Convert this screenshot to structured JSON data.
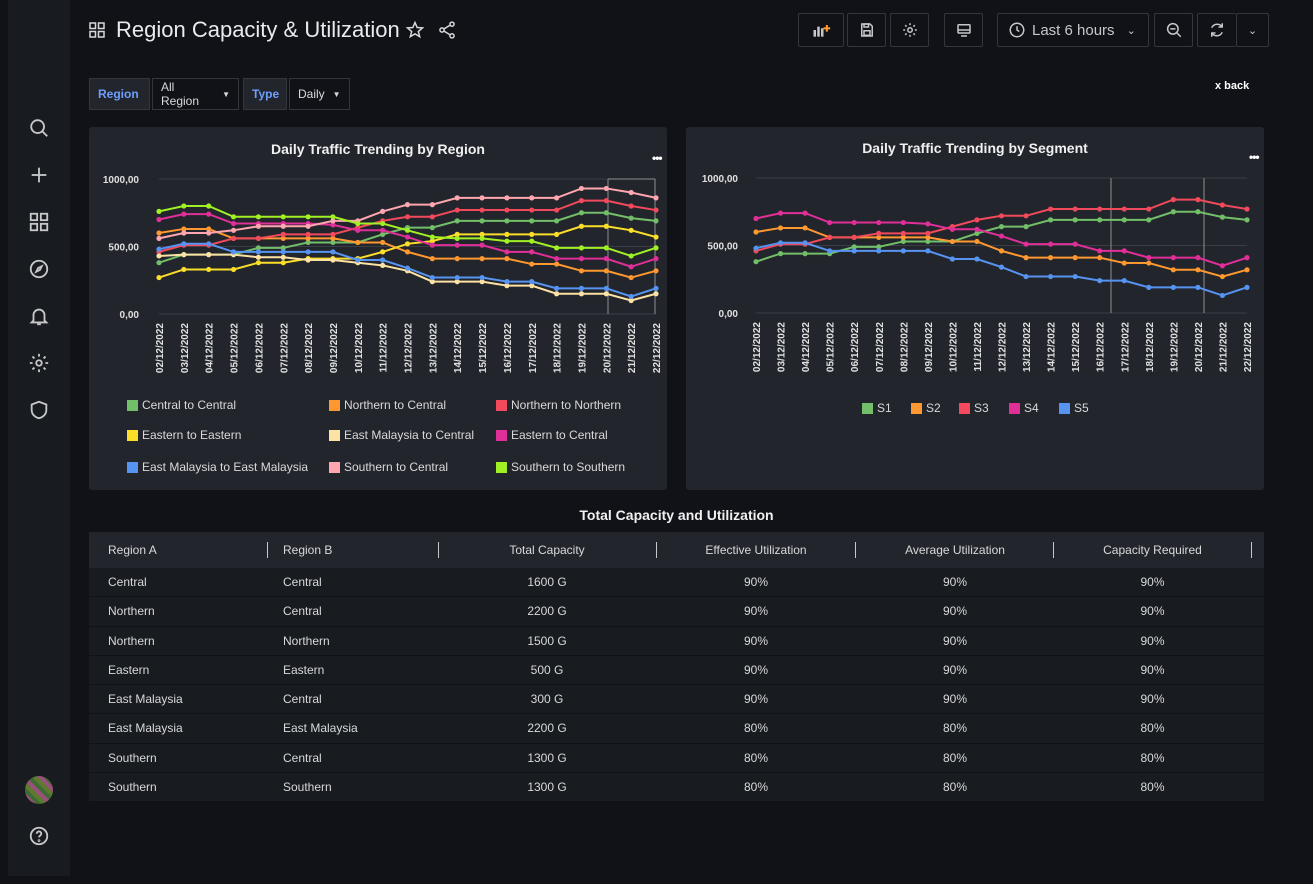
{
  "header": {
    "title": "Region Capacity & Utilization",
    "time_range": "Last 6 hours"
  },
  "filters": {
    "region_label": "Region",
    "region_value": "All Region",
    "type_label": "Type",
    "type_value": "Daily"
  },
  "back_link": "x back",
  "colors": {
    "background": "#111217",
    "panel": "#22252b",
    "accent_label": "#6e9fff"
  },
  "chart_data": [
    {
      "type": "line",
      "title": "Daily Traffic Trending by Region",
      "x": [
        "02/12/2022",
        "03/12/2022",
        "04/12/2022",
        "05/12/2022",
        "06/12/2022",
        "07/12/2022",
        "08/12/2022",
        "09/12/2022",
        "10/12/2022",
        "11/12/2022",
        "12/12/2022",
        "13/12/2022",
        "14/12/2022",
        "15/12/2022",
        "16/12/2022",
        "17/12/2022",
        "18/12/2022",
        "19/12/2022",
        "20/12/2022",
        "21/12/2022",
        "22/12/2022"
      ],
      "y_ticks": [
        "1000,00",
        "500,00",
        "0,00"
      ],
      "ylim": [
        0,
        1000
      ],
      "series": [
        {
          "name": "Central to Central",
          "color": "#73bf69",
          "values": [
            380,
            440,
            440,
            440,
            490,
            490,
            530,
            530,
            530,
            590,
            640,
            640,
            690,
            690,
            690,
            690,
            690,
            750,
            750,
            710,
            690
          ]
        },
        {
          "name": "Northern to Central",
          "color": "#ff9830",
          "values": [
            600,
            630,
            630,
            560,
            560,
            560,
            560,
            560,
            530,
            530,
            460,
            410,
            410,
            410,
            410,
            370,
            370,
            320,
            320,
            270,
            320
          ]
        },
        {
          "name": "Northern to Northern",
          "color": "#f2495c",
          "values": [
            460,
            510,
            510,
            560,
            560,
            590,
            590,
            590,
            640,
            690,
            720,
            720,
            770,
            770,
            770,
            770,
            770,
            840,
            840,
            800,
            770
          ]
        },
        {
          "name": "Eastern to Eastern",
          "color": "#fade2a",
          "values": [
            270,
            330,
            330,
            330,
            380,
            380,
            410,
            410,
            410,
            460,
            520,
            540,
            590,
            590,
            590,
            590,
            590,
            650,
            650,
            620,
            570
          ]
        },
        {
          "name": "East Malaysia to Central",
          "color": "#fce2a4",
          "values": [
            430,
            440,
            440,
            440,
            420,
            420,
            400,
            400,
            380,
            360,
            320,
            240,
            240,
            240,
            210,
            210,
            150,
            150,
            150,
            100,
            150
          ]
        },
        {
          "name": "Eastern to Central",
          "color": "#e02f98",
          "values": [
            700,
            740,
            740,
            670,
            670,
            670,
            670,
            660,
            620,
            620,
            570,
            510,
            510,
            510,
            460,
            460,
            410,
            410,
            410,
            350,
            410
          ]
        },
        {
          "name": "East Malaysia to East Malaysia",
          "color": "#5794f2",
          "values": [
            480,
            520,
            520,
            460,
            460,
            460,
            460,
            460,
            400,
            400,
            340,
            270,
            270,
            270,
            240,
            240,
            190,
            190,
            190,
            130,
            190
          ]
        },
        {
          "name": "Southern to Central",
          "color": "#ffa6b0",
          "values": [
            560,
            600,
            600,
            620,
            650,
            650,
            650,
            690,
            690,
            760,
            810,
            810,
            860,
            860,
            860,
            860,
            860,
            930,
            930,
            900,
            860
          ]
        },
        {
          "name": "Southern to Southern",
          "color": "#a0f024",
          "values": [
            760,
            800,
            800,
            720,
            720,
            720,
            720,
            720,
            670,
            670,
            620,
            570,
            560,
            560,
            540,
            540,
            490,
            490,
            490,
            430,
            490
          ]
        }
      ]
    },
    {
      "type": "line",
      "title": "Daily Traffic Trending by Segment",
      "x": [
        "02/12/2022",
        "03/12/2022",
        "04/12/2022",
        "05/12/2022",
        "06/12/2022",
        "07/12/2022",
        "08/12/2022",
        "09/12/2022",
        "10/12/2022",
        "11/12/2022",
        "12/12/2022",
        "13/12/2022",
        "14/12/2022",
        "15/12/2022",
        "16/12/2022",
        "17/12/2022",
        "18/12/2022",
        "19/12/2022",
        "20/12/2022",
        "21/12/2022",
        "22/12/2022"
      ],
      "y_ticks": [
        "1000,00",
        "500,00",
        "0,00"
      ],
      "ylim": [
        0,
        1000
      ],
      "series": [
        {
          "name": "S1",
          "color": "#73bf69",
          "values": [
            380,
            440,
            440,
            440,
            490,
            490,
            530,
            530,
            530,
            590,
            640,
            640,
            690,
            690,
            690,
            690,
            690,
            750,
            750,
            710,
            690
          ]
        },
        {
          "name": "S2",
          "color": "#ff9830",
          "values": [
            600,
            630,
            630,
            560,
            560,
            560,
            560,
            560,
            530,
            530,
            460,
            410,
            410,
            410,
            410,
            370,
            370,
            320,
            320,
            270,
            320
          ]
        },
        {
          "name": "S3",
          "color": "#f2495c",
          "values": [
            460,
            510,
            510,
            560,
            560,
            590,
            590,
            590,
            640,
            690,
            720,
            720,
            770,
            770,
            770,
            770,
            770,
            840,
            840,
            800,
            770
          ]
        },
        {
          "name": "S4",
          "color": "#e02f98",
          "values": [
            700,
            740,
            740,
            670,
            670,
            670,
            670,
            660,
            620,
            620,
            570,
            510,
            510,
            510,
            460,
            460,
            410,
            410,
            410,
            350,
            410
          ]
        },
        {
          "name": "S5",
          "color": "#5794f2",
          "values": [
            480,
            520,
            520,
            460,
            460,
            460,
            460,
            460,
            400,
            400,
            340,
            270,
            270,
            270,
            240,
            240,
            190,
            190,
            190,
            130,
            190
          ]
        }
      ]
    }
  ],
  "table": {
    "title": "Total Capacity and Utilization",
    "columns": [
      "Region A",
      "Region B",
      "Total Capacity",
      "Effective Utilization",
      "Average Utilization",
      "Capacity Required"
    ],
    "rows": [
      [
        "Central",
        "Central",
        "1600 G",
        "90%",
        "90%",
        "90%"
      ],
      [
        "Northern",
        "Central",
        "2200 G",
        "90%",
        "90%",
        "90%"
      ],
      [
        "Northern",
        "Northern",
        "1500 G",
        "90%",
        "90%",
        "90%"
      ],
      [
        "Eastern",
        "Eastern",
        "500 G",
        "90%",
        "90%",
        "90%"
      ],
      [
        "East Malaysia",
        "Central",
        "300 G",
        "90%",
        "90%",
        "90%"
      ],
      [
        "East Malaysia",
        "East Malaysia",
        "2200 G",
        "80%",
        "80%",
        "80%"
      ],
      [
        "Southern",
        "Central",
        "1300 G",
        "80%",
        "80%",
        "80%"
      ],
      [
        "Southern",
        "Southern",
        "1300 G",
        "80%",
        "80%",
        "80%"
      ]
    ]
  }
}
